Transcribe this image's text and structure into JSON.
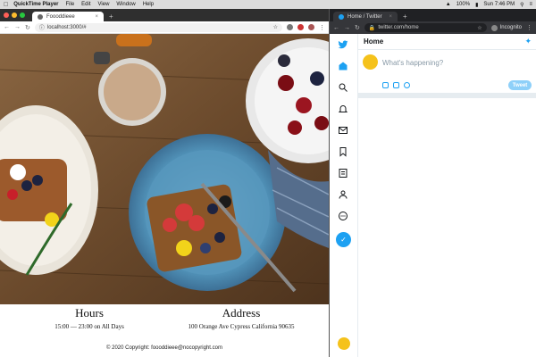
{
  "menubar": {
    "app": "QuickTime Player",
    "items": [
      "File",
      "Edit",
      "View",
      "Window",
      "Help"
    ],
    "battery": "100%",
    "clock": "Sun 7:46 PM"
  },
  "left_window": {
    "tab_title": "Foooddieee",
    "url": "localhost:3000/#",
    "hours": {
      "heading": "Hours",
      "text": "15:00 — 23:00 on All Days"
    },
    "address": {
      "heading": "Address",
      "text": "100 Orange Ave Cypress California 90635"
    },
    "footer": "© 2020 Copyright: foooddieee@nocopyright.com"
  },
  "right_window": {
    "tab_title": "Home / Twitter",
    "url": "twitter.com/home",
    "incognito_label": "Incognito",
    "header_title": "Home",
    "composer_placeholder": "What's happening?",
    "tweet_button": "Tweet",
    "rail_icons": [
      "twitter-logo-icon",
      "home-icon",
      "search-icon",
      "notifications-icon",
      "messages-icon",
      "bookmarks-icon",
      "lists-icon",
      "profile-icon",
      "more-icon"
    ]
  },
  "colors": {
    "twitter_blue": "#1da1f2",
    "tweet_disabled": "#8ed0f9",
    "table_wood": "#6e4b2e",
    "plate_blue": "#4f8fb5"
  }
}
